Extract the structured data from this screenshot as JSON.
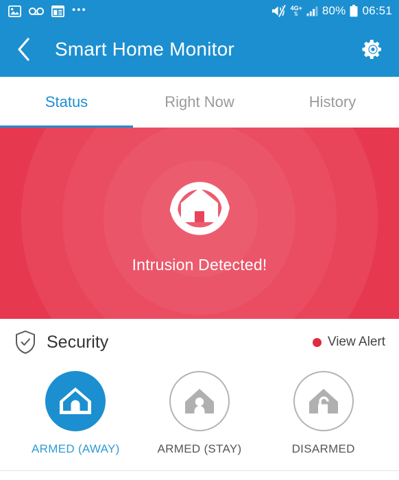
{
  "statusbar": {
    "left_icons": [
      {
        "name": "photo-icon",
        "label": "image"
      },
      {
        "name": "voicemail-icon",
        "label": "voicemail"
      },
      {
        "name": "news-icon",
        "label": "news"
      },
      {
        "name": "more-dots-icon",
        "label": "•••"
      }
    ],
    "mute_icon": "mute-icon",
    "network_type": "4G+",
    "network_arrows": "⇅",
    "signal_icon": "signal-bars-icon",
    "battery_percent": "80%",
    "battery_icon": "battery-icon",
    "clock": "06:51"
  },
  "appbar": {
    "back_label": "‹",
    "title": "Smart Home Monitor",
    "settings_label": "gear"
  },
  "tabs": {
    "items": [
      {
        "label": "Status",
        "active": true
      },
      {
        "label": "Right Now",
        "active": false
      },
      {
        "label": "History",
        "active": false
      }
    ]
  },
  "alert": {
    "message": "Intrusion Detected!",
    "icon": "home-intrusion-icon",
    "background_color": "#e63950",
    "ripple_color": "#ea4d62"
  },
  "security": {
    "icon": "shield-check-icon",
    "title": "Security",
    "view_alert_label": "View Alert",
    "alert_dot_color": "#e02b3f",
    "modes": [
      {
        "label": "ARMED (AWAY)",
        "icon": "home-lock-icon",
        "selected": true
      },
      {
        "label": "ARMED (STAY)",
        "icon": "home-person-icon",
        "selected": false
      },
      {
        "label": "DISARMED",
        "icon": "home-unlock-icon",
        "selected": false
      }
    ]
  },
  "theme": {
    "primary_blue": "#1c8fd0",
    "alert_red": "#e63950",
    "inactive_gray": "#9a9a9a"
  }
}
